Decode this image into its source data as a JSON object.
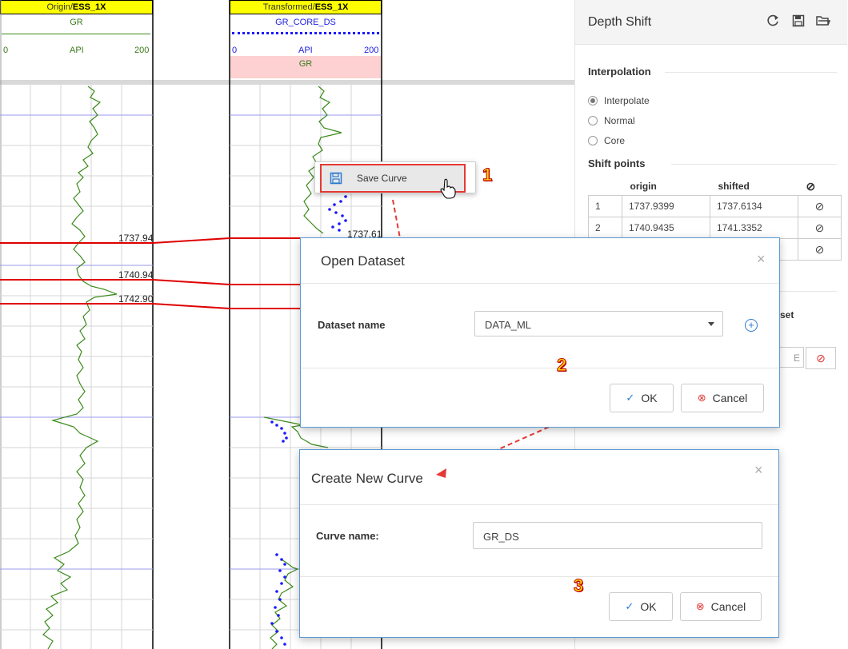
{
  "tracks": {
    "origin": {
      "title_prefix": "Origin/",
      "title_bold": "ESS_1X",
      "curve": "GR",
      "scale_min": "0",
      "scale_unit": "API",
      "scale_max": "200"
    },
    "transformed": {
      "title_prefix": "Transformed/",
      "title_bold": "ESS_1X",
      "curve": "GR_CORE_DS",
      "scale_min": "0",
      "scale_unit": "API",
      "scale_max": "200",
      "curve2": "GR"
    }
  },
  "depth_labels": {
    "a": "1737.94",
    "b": "1740.94",
    "c": "1742.90",
    "d": "1737.61"
  },
  "context_menu": {
    "item": "Save Curve"
  },
  "panel": {
    "title": "Depth Shift",
    "interpolation_title": "Interpolation",
    "options": [
      "Interpolate",
      "Normal",
      "Core"
    ],
    "selected": "Interpolate",
    "shift_points_title": "Shift points",
    "columns": {
      "origin": "origin",
      "shifted": "shifted"
    },
    "rows": [
      {
        "n": "1",
        "origin": "1737.9399",
        "shifted": "1737.6134"
      },
      {
        "n": "2",
        "origin": "1740.9435",
        "shifted": "1741.3352"
      },
      {
        "n": "",
        "origin": "",
        "shifted": ""
      }
    ],
    "partial_text": "set",
    "partial_cell": "E"
  },
  "open_dataset": {
    "title": "Open Dataset",
    "label": "Dataset name",
    "value": "DATA_ML",
    "ok": "OK",
    "cancel": "Cancel"
  },
  "create_curve": {
    "title": "Create New Curve",
    "label": "Curve name:",
    "value": "GR_DS",
    "ok": "OK",
    "cancel": "Cancel"
  },
  "steps": [
    "1",
    "2",
    "3"
  ],
  "colors": {
    "header_yellow": "#ffff00",
    "curve_green": "#3a8a1a",
    "core_blue": "#1a1aff",
    "shift_red": "#e00000",
    "accent_blue": "#2b7bd0",
    "cancel_red": "#e53935"
  }
}
